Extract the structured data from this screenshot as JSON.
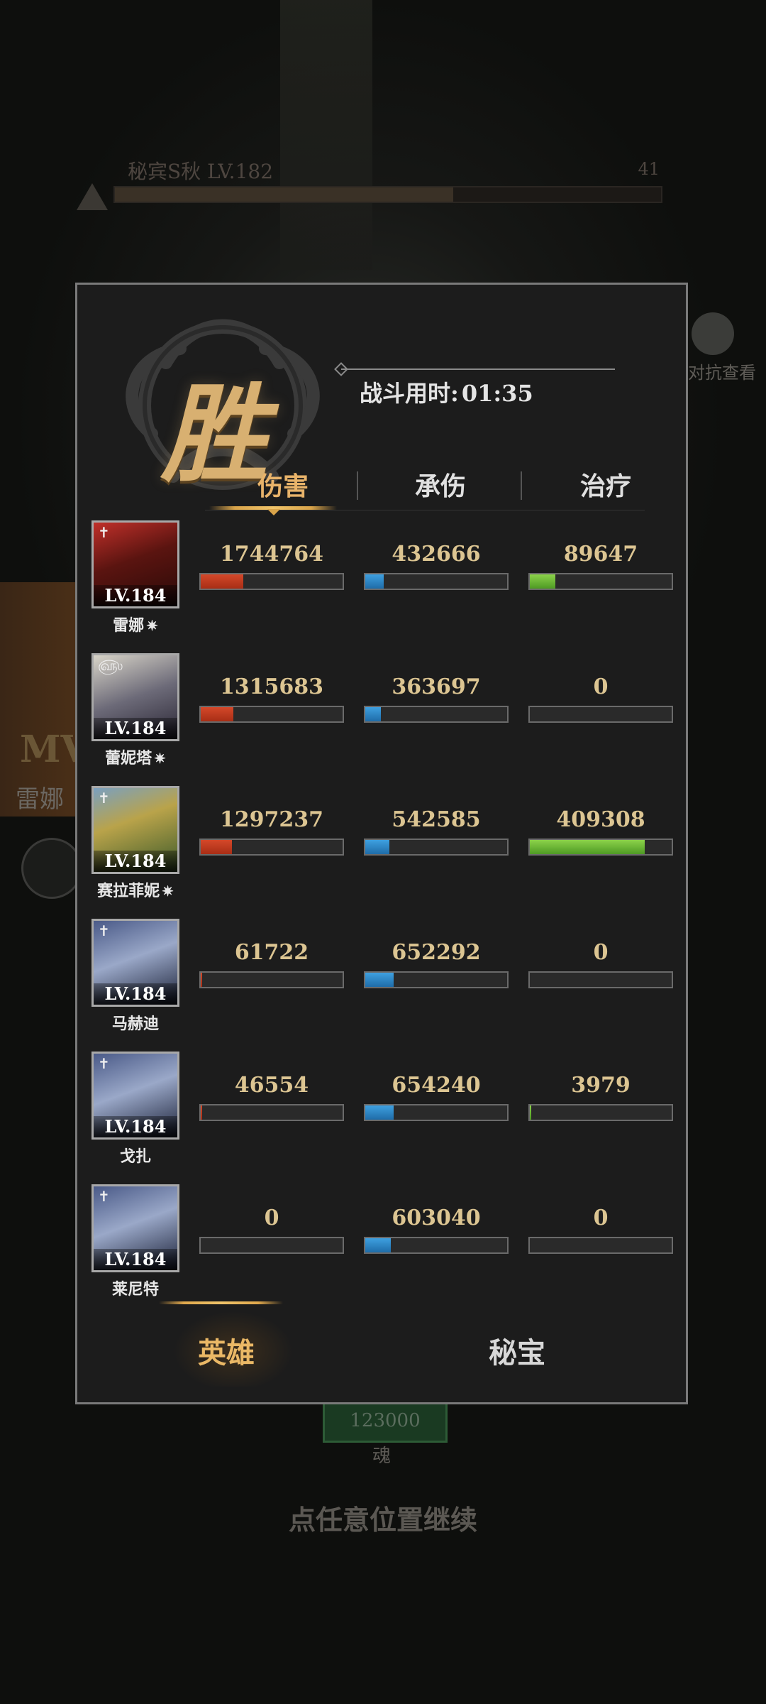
{
  "background": {
    "boss_name": "秘宾S秋 LV.182",
    "boss_count": "41",
    "mvp_label": "MV",
    "left_name": "雷娜",
    "right_label": "对抗查看",
    "reward_value": "123000",
    "reward_label": "魂",
    "continue_hint": "点任意位置继续"
  },
  "result": {
    "victory_char": "胜",
    "battle_time_label": "战斗用时:",
    "battle_time_value": "01:35"
  },
  "stat_tabs": [
    {
      "label": "伤害",
      "active": true
    },
    {
      "label": "承伤",
      "active": false
    },
    {
      "label": "治疗",
      "active": false
    }
  ],
  "heroes": [
    {
      "name": "雷娜",
      "level": "LV.184",
      "class_icon": "dagger-icon",
      "awakened": true,
      "damage": "1744764",
      "damage_ratio": 0.3,
      "taken": "432666",
      "taken_ratio": 0.13,
      "heal": "89647",
      "heal_ratio": 0.18
    },
    {
      "name": "蕾妮塔",
      "level": "LV.184",
      "class_icon": "spiral-icon",
      "awakened": true,
      "damage": "1315683",
      "damage_ratio": 0.23,
      "taken": "363697",
      "taken_ratio": 0.11,
      "heal": "0",
      "heal_ratio": 0
    },
    {
      "name": "赛拉菲妮",
      "level": "LV.184",
      "class_icon": "cross-icon",
      "awakened": true,
      "damage": "1297237",
      "damage_ratio": 0.22,
      "taken": "542585",
      "taken_ratio": 0.17,
      "heal": "409308",
      "heal_ratio": 0.81
    },
    {
      "name": "马赫迪",
      "level": "LV.184",
      "class_icon": "cross-icon",
      "awakened": false,
      "damage": "61722",
      "damage_ratio": 0.01,
      "taken": "652292",
      "taken_ratio": 0.2,
      "heal": "0",
      "heal_ratio": 0
    },
    {
      "name": "戈扎",
      "level": "LV.184",
      "class_icon": "cross-icon",
      "awakened": false,
      "damage": "46554",
      "damage_ratio": 0.01,
      "taken": "654240",
      "taken_ratio": 0.2,
      "heal": "3979",
      "heal_ratio": 0.01
    },
    {
      "name": "莱尼特",
      "level": "LV.184",
      "class_icon": "cross-icon",
      "awakened": false,
      "damage": "0",
      "damage_ratio": 0,
      "taken": "603040",
      "taken_ratio": 0.18,
      "heal": "0",
      "heal_ratio": 0
    }
  ],
  "bottom_tabs": [
    {
      "label": "英雄",
      "active": true
    },
    {
      "label": "秘宝",
      "active": false
    }
  ],
  "colors": {
    "accent_gold": "#e8b36a",
    "damage": "#d4482a",
    "taken": "#3ea0e0",
    "heal": "#8cd24a"
  }
}
